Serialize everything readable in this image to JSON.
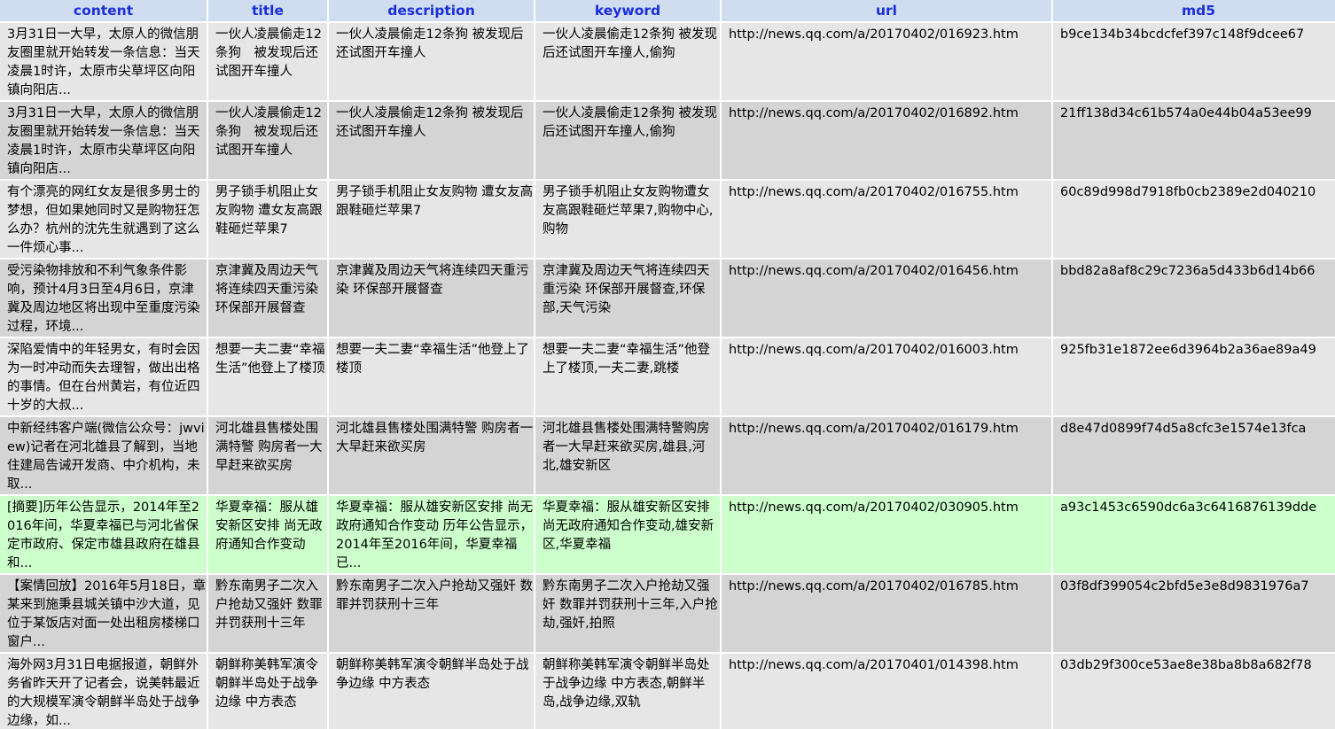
{
  "columns": {
    "content": "content",
    "title": "title",
    "description": "description",
    "keyword": "keyword",
    "url": "url",
    "md5": "md5"
  },
  "rows": [
    {
      "content": "3月31日一大早，太原人的微信朋友圈里就开始转发一条信息：当天凌晨1时许，太原市尖草坪区向阳镇向阳店...",
      "title": "一伙人凌晨偷走12条狗　被发现后还试图开车撞人",
      "description": "一伙人凌晨偷走12条狗 被发现后还试图开车撞人",
      "keyword": "一伙人凌晨偷走12条狗 被发现后还试图开车撞人,偷狗",
      "url": "http://news.qq.com/a/20170402/016923.htm",
      "md5": "b9ce134b34bcdcfef397c148f9dcee67"
    },
    {
      "content": "3月31日一大早，太原人的微信朋友圈里就开始转发一条信息：当天凌晨1时许，太原市尖草坪区向阳镇向阳店...",
      "title": "一伙人凌晨偷走12条狗　被发现后还试图开车撞人",
      "description": "一伙人凌晨偷走12条狗 被发现后还试图开车撞人",
      "keyword": "一伙人凌晨偷走12条狗 被发现后还试图开车撞人,偷狗",
      "url": "http://news.qq.com/a/20170402/016892.htm",
      "md5": "21ff138d34c61b574a0e44b04a53ee99"
    },
    {
      "content": "有个漂亮的网红女友是很多男士的梦想，但如果她同时又是购物狂怎么办？杭州的沈先生就遇到了这么一件烦心事...",
      "title": "男子锁手机阻止女友购物 遭女友高跟鞋砸烂苹果7",
      "description": "男子锁手机阻止女友购物 遭女友高跟鞋砸烂苹果7",
      "keyword": "男子锁手机阻止女友购物遭女友高跟鞋砸烂苹果7,购物中心,购物",
      "url": "http://news.qq.com/a/20170402/016755.htm",
      "md5": "60c89d998d7918fb0cb2389e2d040210"
    },
    {
      "content": "受污染物排放和不利气象条件影响，预计4月3日至4月6日，京津冀及周边地区将出现中至重度污染过程，环境...",
      "title": "京津冀及周边天气将连续四天重污染 环保部开展督查",
      "description": "京津冀及周边天气将连续四天重污染 环保部开展督查",
      "keyword": "京津冀及周边天气将连续四天重污染 环保部开展督查,环保部,天气污染",
      "url": "http://news.qq.com/a/20170402/016456.htm",
      "md5": "bbd82a8af8c29c7236a5d433b6d14b66"
    },
    {
      "content": "深陷爱情中的年轻男女，有时会因为一时冲动而失去理智，做出出格的事情。但在台州黄岩，有位近四十岁的大叔...",
      "title": "想要一夫二妻“幸福生活”他登上了楼顶",
      "description": "想要一夫二妻“幸福生活”他登上了楼顶",
      "keyword": "想要一夫二妻“幸福生活”他登上了楼顶,一夫二妻,跳楼",
      "url": "http://news.qq.com/a/20170402/016003.htm",
      "md5": "925fb31e1872ee6d3964b2a36ae89a49"
    },
    {
      "content": "中新经纬客户端(微信公众号：jwview)记者在河北雄县了解到，当地住建局告诫开发商、中介机构，未取...",
      "title": "河北雄县售楼处围满特警 购房者一大早赶来欲买房",
      "description": "河北雄县售楼处围满特警 购房者一大早赶来欲买房",
      "keyword": "河北雄县售楼处围满特警购房者一大早赶来欲买房,雄县,河北,雄安新区",
      "url": "http://news.qq.com/a/20170402/016179.htm",
      "md5": "d8e47d0899f74d5a8cfc3e1574e13fca"
    },
    {
      "content": "[摘要]历年公告显示，2014年至2016年间，华夏幸福已与河北省保定市政府、保定市雄县政府在雄县和...",
      "title": "华夏幸福：服从雄安新区安排 尚无政府通知合作变动",
      "description": "华夏幸福：服从雄安新区安排 尚无政府通知合作变动 历年公告显示，2014年至2016年间，华夏幸福已...",
      "keyword": "华夏幸福：服从雄安新区安排 尚无政府通知合作变动,雄安新区,华夏幸福",
      "url": "http://news.qq.com/a/20170402/030905.htm",
      "md5": "a93c1453c6590dc6a3c6416876139dde",
      "highlight": true
    },
    {
      "content": "【案情回放】2016年5月18日，章某来到施秉县城关镇中沙大道，见位于某饭店对面一处出租房楼梯口窗户...",
      "title": "黔东南男子二次入户抢劫又强奸 数罪并罚获刑十三年",
      "description": "黔东南男子二次入户抢劫又强奸 数罪并罚获刑十三年",
      "keyword": "黔东南男子二次入户抢劫又强奸 数罪并罚获刑十三年,入户抢劫,强奸,拍照",
      "url": "http://news.qq.com/a/20170402/016785.htm",
      "md5": "03f8df399054c2bfd5e3e8d9831976a7"
    },
    {
      "content": "海外网3月31日电据报道，朝鲜外务省昨天开了记者会，说美韩最近的大规模军演令朝鲜半岛处于战争边缘，如...",
      "title": "朝鲜称美韩军演令朝鲜半岛处于战争边缘 中方表态",
      "description": "朝鲜称美韩军演令朝鲜半岛处于战争边缘 中方表态",
      "keyword": "朝鲜称美韩军演令朝鲜半岛处于战争边缘 中方表态,朝鲜半岛,战争边缘,双轨",
      "url": "http://news.qq.com/a/20170401/014398.htm",
      "md5": "03db29f300ce53ae8e38ba8b8a682f78"
    }
  ]
}
